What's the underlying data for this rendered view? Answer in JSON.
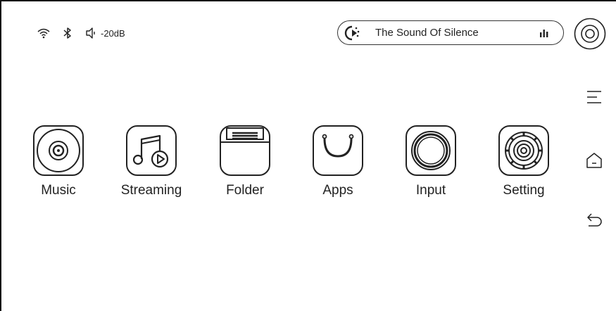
{
  "status": {
    "wifi_icon": "wifi-icon",
    "bluetooth_icon": "bluetooth-icon",
    "volume_icon": "speaker-icon",
    "volume_text": "-20dB"
  },
  "now_playing": {
    "title": "The Sound Of Silence",
    "left_icon": "loading-spinner-icon",
    "right_icon": "equalizer-bars-icon"
  },
  "disc_button_icon": "disc-icon",
  "side_nav": {
    "menu_icon": "menu-icon",
    "home_icon": "home-icon",
    "back_icon": "back-arrow-icon"
  },
  "apps": [
    {
      "label": "Music",
      "icon": "vinyl-disc-icon"
    },
    {
      "label": "Streaming",
      "icon": "music-note-play-icon"
    },
    {
      "label": "Folder",
      "icon": "folder-icon"
    },
    {
      "label": "Apps",
      "icon": "shopping-bag-icon"
    },
    {
      "label": "Input",
      "icon": "input-ring-icon"
    },
    {
      "label": "Setting",
      "icon": "gear-icon"
    }
  ]
}
